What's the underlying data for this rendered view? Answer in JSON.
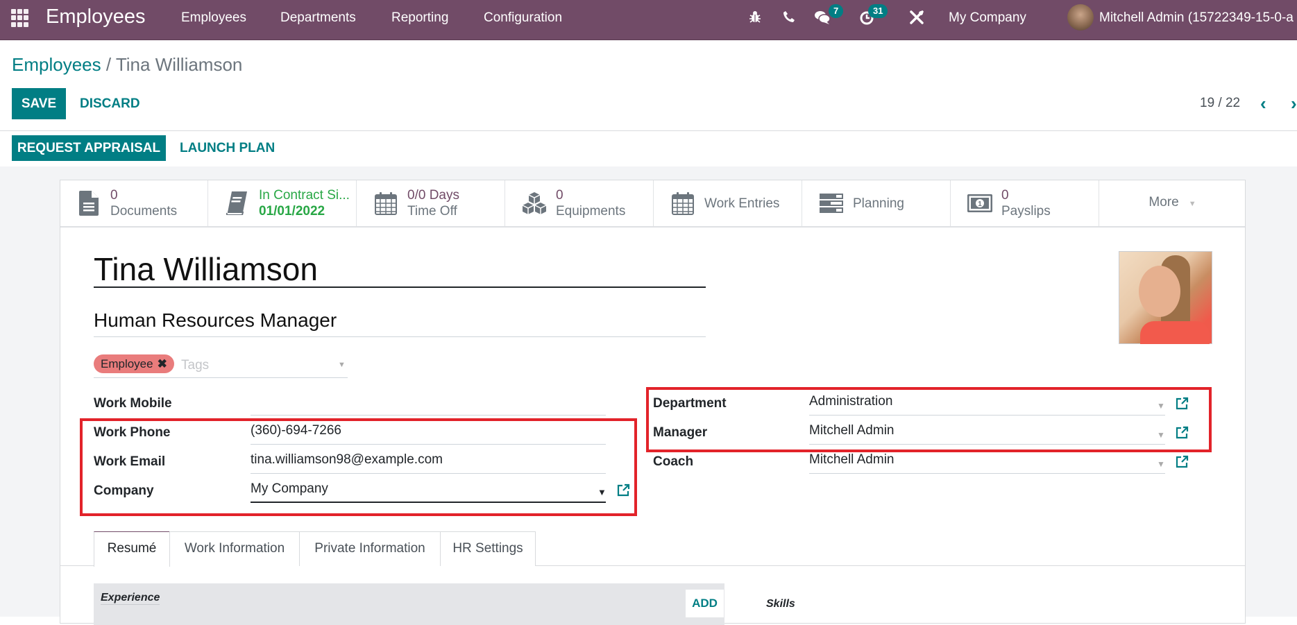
{
  "navbar": {
    "app_title": "Employees",
    "menu": [
      "Employees",
      "Departments",
      "Reporting",
      "Configuration"
    ],
    "icons": [
      "apps-grid-icon",
      "bug-icon",
      "phone-icon",
      "chat-icon",
      "activity-clock-icon",
      "tools-icon"
    ],
    "messages_count": "7",
    "activities_count": "31",
    "company": "My Company",
    "user": "Mitchell Admin (15722349-15-0-a"
  },
  "breadcrumb": {
    "parent": "Employees",
    "separator": "/",
    "current": "Tina Williamson"
  },
  "control": {
    "save_label": "SAVE",
    "discard_label": "DISCARD",
    "pager": "19 / 22"
  },
  "actions": {
    "request_appraisal": "REQUEST APPRAISAL",
    "launch_plan": "LAUNCH PLAN"
  },
  "stat_buttons": [
    {
      "icon": "document-icon",
      "value": "0",
      "label": "Documents"
    },
    {
      "icon": "book-icon",
      "value": "In Contract Si...",
      "label": "01/01/2022"
    },
    {
      "icon": "calendar-icon",
      "value": "0/0 Days",
      "label": "Time Off"
    },
    {
      "icon": "cubes-icon",
      "value": "0",
      "label": "Equipments"
    },
    {
      "icon": "calendar-icon",
      "value": "",
      "label": "Work Entries"
    },
    {
      "icon": "server-icon",
      "value": "",
      "label": "Planning"
    },
    {
      "icon": "money-icon",
      "value": "0",
      "label": "Payslips"
    },
    {
      "icon": "caret-down-icon",
      "value": "",
      "label": "More"
    }
  ],
  "employee": {
    "name": "Tina Williamson",
    "job_title": "Human Resources Manager",
    "tags": [
      "Employee"
    ],
    "tags_placeholder": "Tags"
  },
  "left_fields": [
    {
      "label": "Work Mobile",
      "value": ""
    },
    {
      "label": "Work Phone",
      "value": "(360)-694-7266"
    },
    {
      "label": "Work Email",
      "value": "tina.williamson98@example.com"
    },
    {
      "label": "Company",
      "value": "My Company"
    }
  ],
  "right_fields": [
    {
      "label": "Department",
      "value": "Administration"
    },
    {
      "label": "Manager",
      "value": "Mitchell Admin"
    },
    {
      "label": "Coach",
      "value": "Mitchell Admin"
    }
  ],
  "tabs": [
    "Resumé",
    "Work Information",
    "Private Information",
    "HR Settings"
  ],
  "active_tab": "Resumé",
  "resume": {
    "experience_label": "Experience",
    "add_label": "ADD",
    "skills_label": "Skills"
  },
  "colors": {
    "brand": "#714b67",
    "primary": "#017e84",
    "highlight_box": "#e2232a",
    "tag": "#e97c7c"
  }
}
